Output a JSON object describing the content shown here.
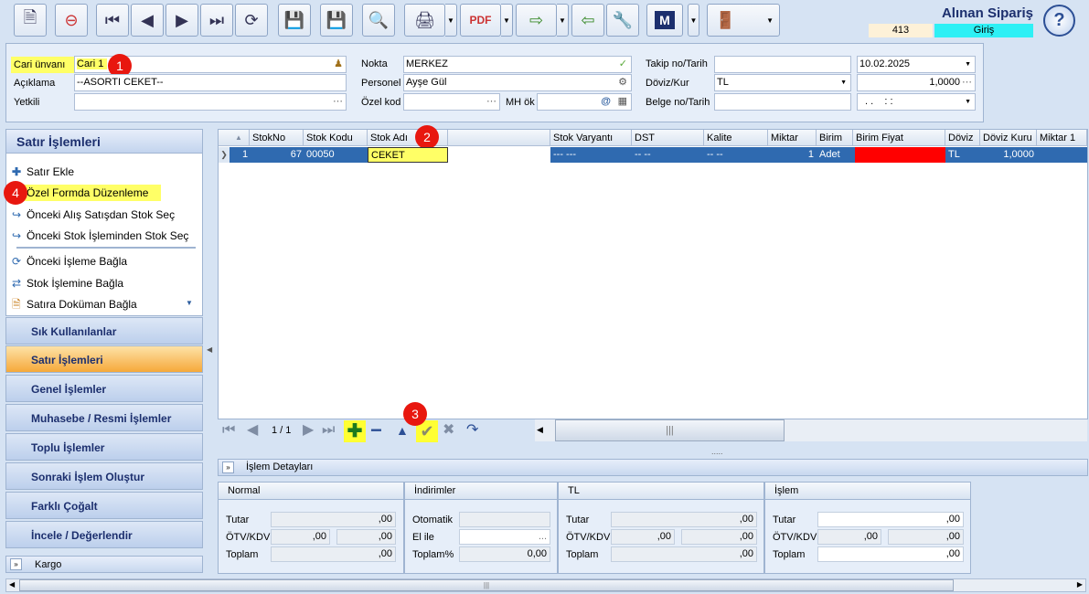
{
  "title": "Alınan Sipariş",
  "doc_number": "413",
  "mode": "Giriş",
  "toolbar": {
    "icons": [
      "new-document-icon",
      "delete-document-icon",
      "first-record-icon",
      "previous-record-icon",
      "next-record-icon",
      "last-record-icon",
      "refresh-icon",
      "save-icon",
      "save-close-icon",
      "preview-icon",
      "print-icon",
      "pdf-icon",
      "export-icon",
      "import-icon",
      "tools-icon",
      "m-icon",
      "exit-icon"
    ],
    "m_label": "M"
  },
  "header": {
    "cari_unvani_label": "Cari ünvanı",
    "cari_unvani_value": "Cari 1",
    "aciklama_label": "Açıklama",
    "aciklama_value": "--ASORTI CEKET--",
    "yetkili_label": "Yetkili",
    "nokta_label": "Nokta",
    "nokta_value": "MERKEZ",
    "personel_label": "Personel",
    "personel_value": "Ayşe Gül",
    "ozel_kod_label": "Özel kod",
    "mh_ok_label": "MH ök",
    "takip_label": "Takip no/Tarih",
    "tarih_value": "10.02.2025",
    "doviz_label": "Döviz/Kur",
    "doviz_value": "TL",
    "kur_value": "1,0000",
    "belge_label": "Belge no/Tarih",
    "belge_tarih_value": ". .    : :"
  },
  "badges": [
    "1",
    "2",
    "3",
    "4"
  ],
  "sidebar": {
    "header": "Satır İşlemleri",
    "items": [
      "Satır Ekle",
      "Özel Formda Düzenleme",
      "Önceki Alış Satışdan Stok Seç",
      "Önceki Stok İşleminden Stok Seç",
      "Önceki İşleme Bağla",
      "Stok İşlemine Bağla",
      "Satıra Doküman Bağla"
    ],
    "groups": [
      "Sık Kullanılanlar",
      "Satır İşlemleri",
      "Genel İşlemler",
      "Muhasebe / Resmi İşlemler",
      "Toplu İşlemler",
      "Sonraki İşlem Oluştur",
      "Farklı Çoğalt",
      "İncele / Değerlendir"
    ],
    "kargo": "Kargo"
  },
  "grid": {
    "columns": [
      "StokNo",
      "Stok Kodu",
      "Stok Adı",
      "Stok Varyantı",
      "DST",
      "Kalite",
      "Miktar",
      "Birim",
      "Birim Fiyat",
      "Döviz",
      "Döviz Kuru",
      "Miktar 1"
    ],
    "row": {
      "index": "1",
      "stok_no": "67",
      "stok_kodu": "00050",
      "stok_adi": "CEKET",
      "varyant": "--- ---",
      "dst": "-- --",
      "kalite": "-- --",
      "miktar": "1",
      "birim": "Adet",
      "birim_fiyat": "",
      "doviz": "TL",
      "doviz_kuru": "1,0000"
    }
  },
  "navigator": {
    "page": "1 / 1"
  },
  "details": {
    "bar_label": "İşlem Detayları",
    "normal": {
      "header": "Normal",
      "tutar_label": "Tutar",
      "tutar": ",00",
      "otv_label": "ÖTV/KDV",
      "otv1": ",00",
      "otv2": ",00",
      "toplam_label": "Toplam",
      "toplam": ",00"
    },
    "indirim": {
      "header": "İndirimler",
      "otomatik_label": "Otomatik",
      "elile_label": "El ile",
      "elile": "...",
      "toplam_label": "Toplam%",
      "toplam": "0,00"
    },
    "tl": {
      "header": "TL",
      "tutar_label": "Tutar",
      "tutar": ",00",
      "otv_label": "ÖTV/KDV",
      "otv1": ",00",
      "otv2": ",00",
      "toplam_label": "Toplam",
      "toplam": ",00"
    },
    "islem": {
      "header": "İşlem",
      "tutar_label": "Tutar",
      "tutar": ",00",
      "otv_label": "ÖTV/KDV",
      "otv1": ",00",
      "otv2": ",00",
      "toplam_label": "Toplam",
      "toplam": ",00"
    }
  },
  "colors": {
    "highlight": "#ffff66",
    "selected_row": "#2f6ab0",
    "price_cell": "#ff0000",
    "giris": "#2ef0f5",
    "badge": "#e8170f"
  }
}
